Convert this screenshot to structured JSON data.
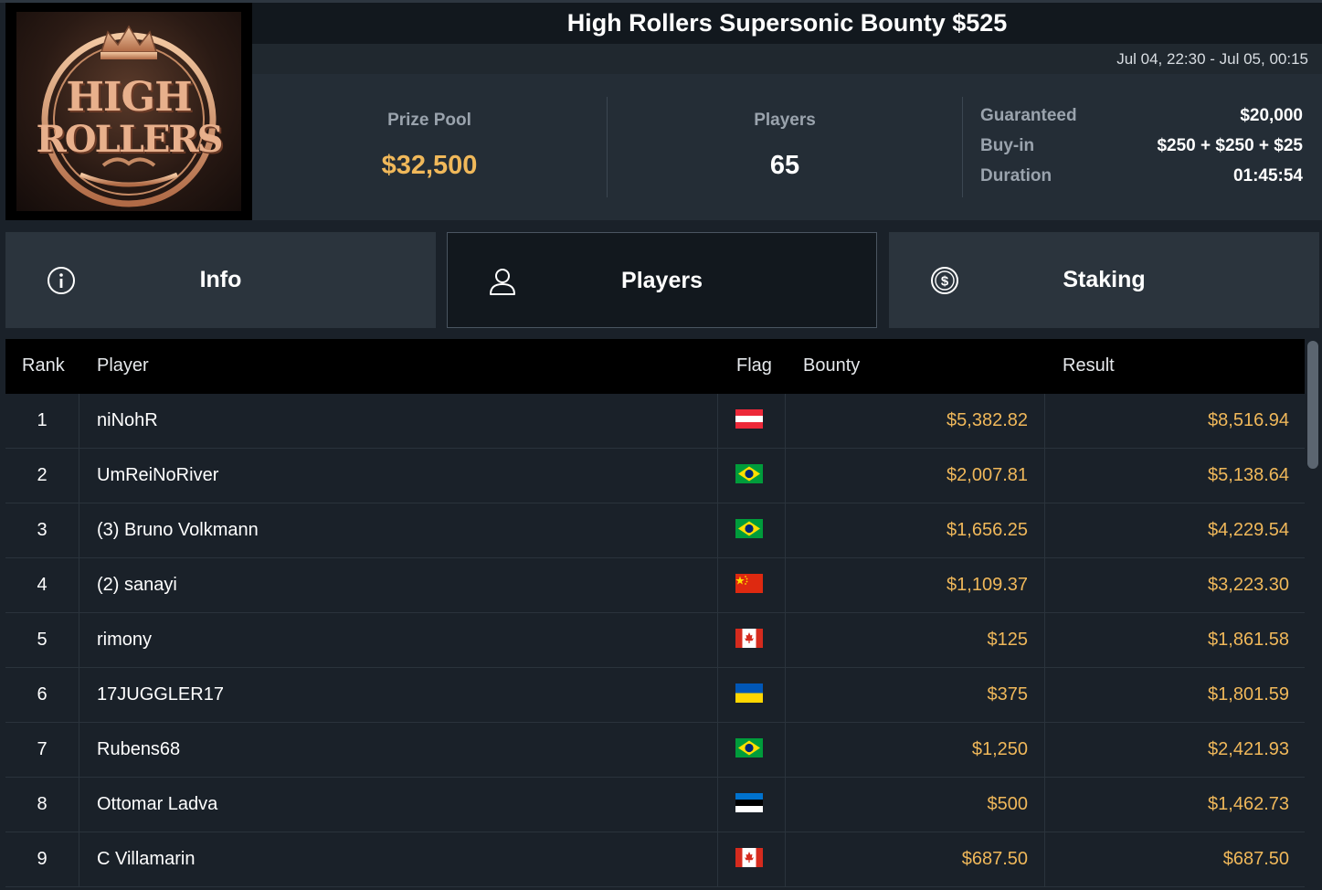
{
  "header": {
    "logo_text_top": "HIGH",
    "logo_text_bottom": "ROLLERS",
    "title": "High Rollers Supersonic Bounty $525",
    "date_range": "Jul 04, 22:30 - Jul 05, 00:15"
  },
  "stats": {
    "prize_pool_label": "Prize Pool",
    "prize_pool_value": "$32,500",
    "players_label": "Players",
    "players_value": "65",
    "details": [
      {
        "label": "Guaranteed",
        "value": "$20,000"
      },
      {
        "label": "Buy-in",
        "value": "$250 + $250 + $25"
      },
      {
        "label": "Duration",
        "value": "01:45:54"
      }
    ]
  },
  "tabs": [
    {
      "label": "Info",
      "icon": "info-icon",
      "active": false
    },
    {
      "label": "Players",
      "icon": "user-icon",
      "active": true
    },
    {
      "label": "Staking",
      "icon": "dollar-icon",
      "active": false
    }
  ],
  "table": {
    "columns": [
      "Rank",
      "Player",
      "Flag",
      "Bounty",
      "Result"
    ],
    "rows": [
      {
        "rank": "1",
        "player": "niNohR",
        "flag": "austria",
        "bounty": "$5,382.82",
        "result": "$8,516.94"
      },
      {
        "rank": "2",
        "player": "UmReiNoRiver",
        "flag": "brazil",
        "bounty": "$2,007.81",
        "result": "$5,138.64"
      },
      {
        "rank": "3",
        "player": "(3) Bruno Volkmann",
        "flag": "brazil",
        "bounty": "$1,656.25",
        "result": "$4,229.54"
      },
      {
        "rank": "4",
        "player": "(2) sanayi",
        "flag": "china",
        "bounty": "$1,109.37",
        "result": "$3,223.30"
      },
      {
        "rank": "5",
        "player": "rimony",
        "flag": "canada",
        "bounty": "$125",
        "result": "$1,861.58"
      },
      {
        "rank": "6",
        "player": "17JUGGLER17",
        "flag": "ukraine",
        "bounty": "$375",
        "result": "$1,801.59"
      },
      {
        "rank": "7",
        "player": "Rubens68",
        "flag": "brazil",
        "bounty": "$1,250",
        "result": "$2,421.93"
      },
      {
        "rank": "8",
        "player": "Ottomar Ladva",
        "flag": "estonia",
        "bounty": "$500",
        "result": "$1,462.73"
      },
      {
        "rank": "9",
        "player": "C Villamarin",
        "flag": "canada",
        "bounty": "$687.50",
        "result": "$687.50"
      }
    ]
  },
  "colors": {
    "accent_gold": "#f0b85a",
    "background": "#1a2129",
    "panel": "#242d36"
  }
}
